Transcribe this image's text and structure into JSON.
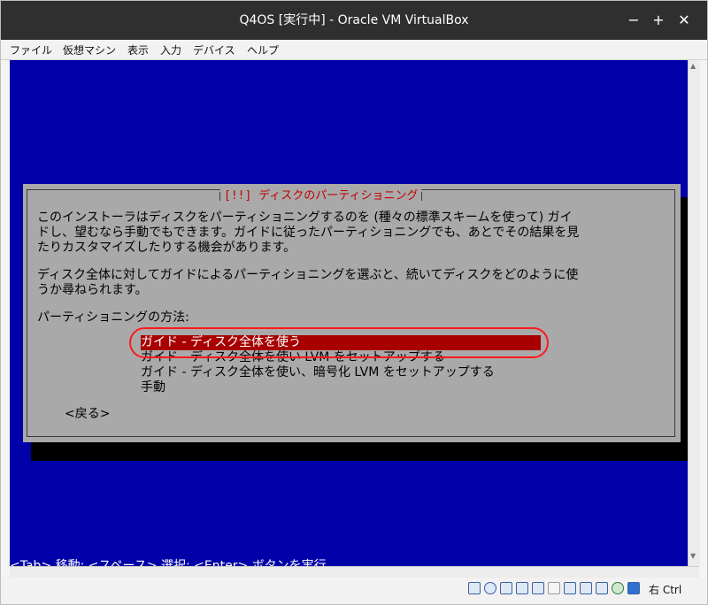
{
  "window": {
    "title": "Q4OS [実行中] - Oracle VM VirtualBox",
    "minimize_glyph": "−",
    "maximize_glyph": "+",
    "close_glyph": "✕"
  },
  "menu": {
    "items": [
      "ファイル",
      "仮想マシン",
      "表示",
      "入力",
      "デバイス",
      "ヘルプ"
    ]
  },
  "dialog": {
    "title": "[!!] ディスクのパーティショニング",
    "paragraph1": [
      "このインストーラはディスクをパーティショニングするのを (種々の標準スキームを使って) ガイ",
      "ドし、望むなら手動でもできます。ガイドに従ったパーティショニングでも、あとでその結果を見",
      "たりカスタマイズしたりする機会があります。"
    ],
    "paragraph2": [
      "ディスク全体に対してガイドによるパーティショニングを選ぶと、続いてディスクをどのように使",
      "うか尋ねられます。"
    ],
    "method_label": "パーティショニングの方法:",
    "options": [
      "ガイド - ディスク全体を使う",
      "ガイド - ディスク全体を使い LVM をセットアップする",
      "ガイド - ディスク全体を使い、暗号化 LVM をセットアップする",
      "手動"
    ],
    "selected_index": 0,
    "back_label": "<戻る>"
  },
  "help_line": "<Tab> 移動; <スペース> 選択; <Enter> ボタンを実行",
  "statusbar": {
    "host_key": "右 Ctrl",
    "icons": [
      "hard-disk-icon",
      "optical-drive-icon",
      "audio-icon",
      "network-icon",
      "usb-icon",
      "shared-folder-icon",
      "display-icon",
      "screen-capture-icon",
      "video-capture-icon",
      "mouse-integration-icon",
      "download-icon"
    ]
  },
  "colors": {
    "vm_background": "#0000a8",
    "dialog_background": "#a9a9a9",
    "dialog_title": "#c00000",
    "selected_option": "#a80000",
    "annotation_ring": "#ff1a1a"
  }
}
